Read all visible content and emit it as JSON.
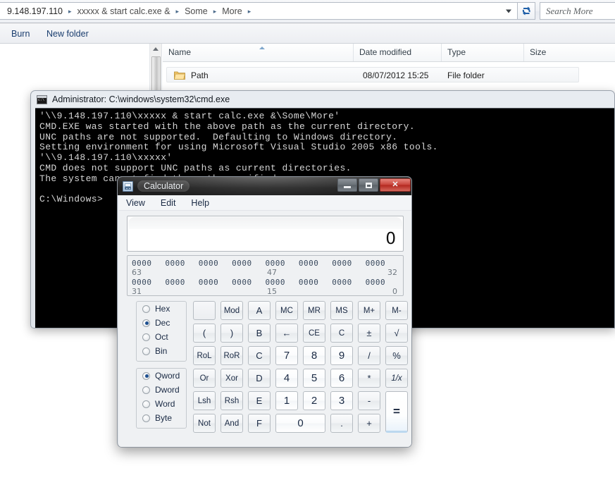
{
  "explorer": {
    "address": {
      "crumbs": [
        "9.148.197.110",
        "xxxxx & start calc.exe &",
        "Some",
        "More"
      ],
      "separator": "▸",
      "dropdown_icon": "chevron-down-icon",
      "refresh_icon": "refresh-icon"
    },
    "search": {
      "placeholder": "Search More",
      "icon": "search-icon"
    },
    "toolbar": {
      "burn_label": "Burn",
      "newfolder_label": "New folder"
    },
    "columns": [
      "Name",
      "Date modified",
      "Type",
      "Size"
    ],
    "rows": [
      {
        "name": "Path",
        "date_modified": "08/07/2012 15:25",
        "type": "File folder",
        "size": "",
        "icon": "folder-icon"
      }
    ]
  },
  "cmd": {
    "title": "Administrator: C:\\windows\\system32\\cmd.exe",
    "icon": "console-icon",
    "lines": [
      "'\\\\9.148.197.110\\xxxxx & start calc.exe &\\Some\\More'",
      "CMD.EXE was started with the above path as the current directory.",
      "UNC paths are not supported.  Defaulting to Windows directory.",
      "Setting environment for using Microsoft Visual Studio 2005 x86 tools.",
      "'\\\\9.148.197.110\\xxxxx'",
      "CMD does not support UNC paths as current directories.",
      "The system cannot find the path specified.",
      "",
      "C:\\Windows>"
    ]
  },
  "calculator": {
    "title": "Calculator",
    "icon": "calculator-icon",
    "window_buttons": {
      "minimize": "minimize-icon",
      "maximize": "maximize-icon",
      "close": "✕"
    },
    "menu": [
      "View",
      "Edit",
      "Help"
    ],
    "display_value": "0",
    "bitgrid": {
      "row1_nibbles": [
        "0000",
        "0000",
        "0000",
        "0000",
        "0000",
        "0000",
        "0000",
        "0000"
      ],
      "row1_labels": {
        "left": "63",
        "mid": "47",
        "right": "32"
      },
      "row2_nibbles": [
        "0000",
        "0000",
        "0000",
        "0000",
        "0000",
        "0000",
        "0000",
        "0000"
      ],
      "row2_labels": {
        "left": "31",
        "mid": "15",
        "right": "0"
      }
    },
    "base_options": [
      {
        "label": "Hex",
        "selected": false
      },
      {
        "label": "Dec",
        "selected": true
      },
      {
        "label": "Oct",
        "selected": false
      },
      {
        "label": "Bin",
        "selected": false
      }
    ],
    "word_options": [
      {
        "label": "Qword",
        "selected": true
      },
      {
        "label": "Dword",
        "selected": false
      },
      {
        "label": "Word",
        "selected": false
      },
      {
        "label": "Byte",
        "selected": false
      }
    ],
    "buttons": {
      "r1": [
        "",
        "Mod",
        "A",
        "MC",
        "MR",
        "MS",
        "M+",
        "M-"
      ],
      "r2": [
        "(",
        ")",
        "B",
        "←",
        "CE",
        "C",
        "±",
        "√"
      ],
      "r3": [
        "RoL",
        "RoR",
        "C",
        "7",
        "8",
        "9",
        "/",
        "%"
      ],
      "r4": [
        "Or",
        "Xor",
        "D",
        "4",
        "5",
        "6",
        "*",
        "1/x"
      ],
      "r5": [
        "Lsh",
        "Rsh",
        "E",
        "1",
        "2",
        "3",
        "-",
        "="
      ],
      "r6": [
        "Not",
        "And",
        "F",
        "0",
        ".",
        "+"
      ]
    }
  }
}
